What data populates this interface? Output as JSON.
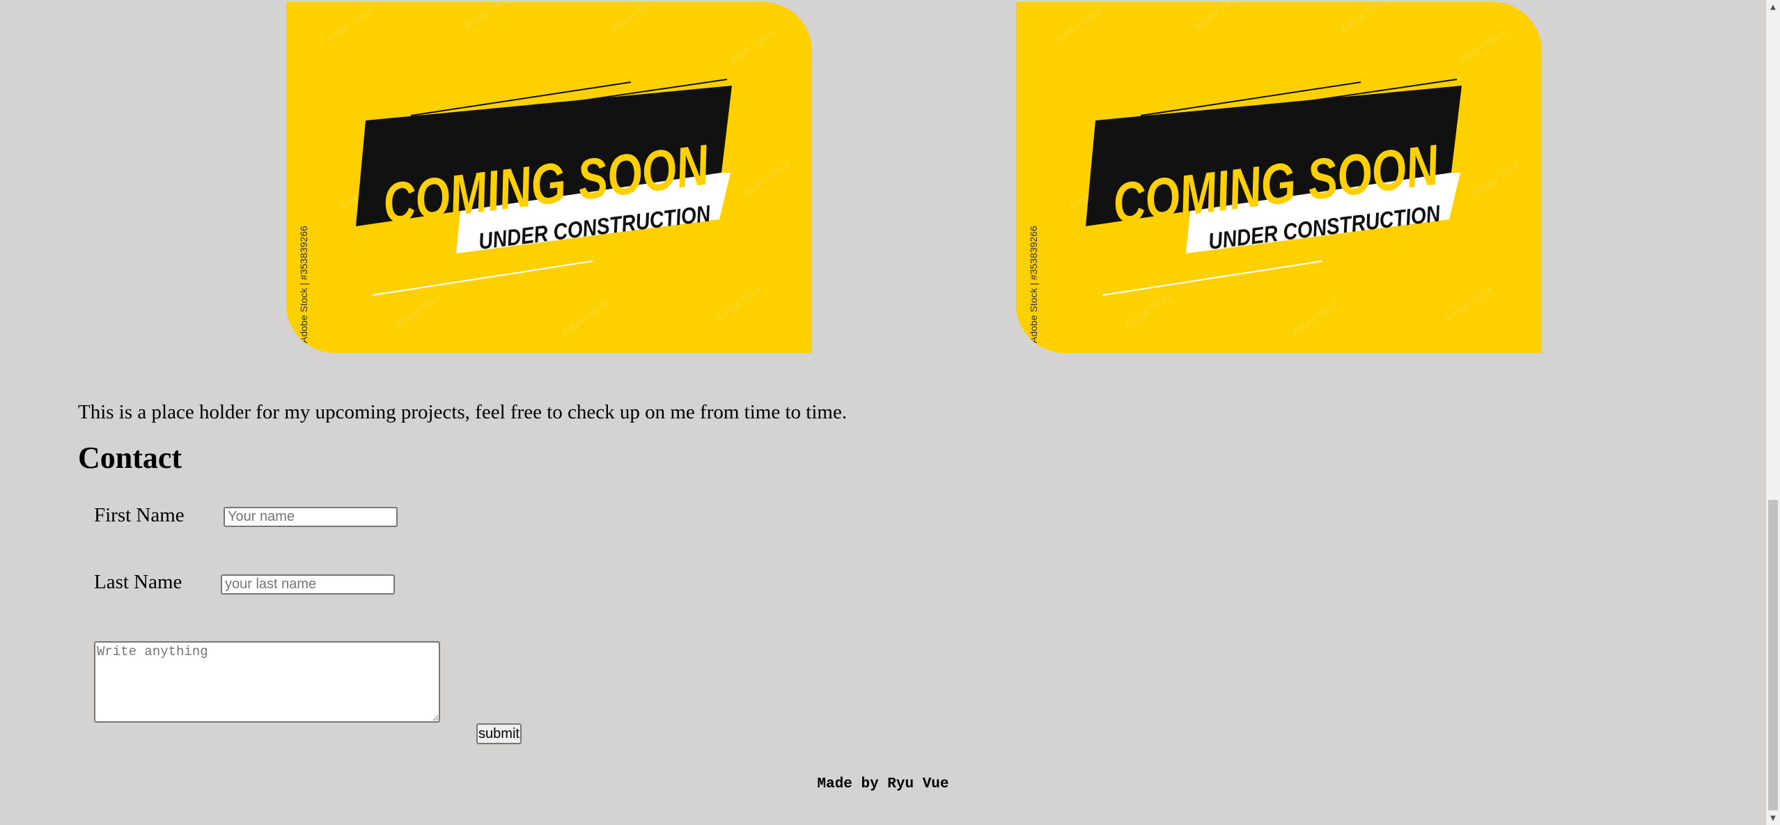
{
  "projects": {
    "cards": [
      {
        "headline": "COMING SOON",
        "subline": "UNDER CONSTRUCTION",
        "watermark_side": "Adobe Stock | #353839266",
        "watermark_tile": "Adobe Stock"
      },
      {
        "headline": "COMING SOON",
        "subline": "UNDER CONSTRUCTION",
        "watermark_side": "Adobe Stock | #353839266",
        "watermark_tile": "Adobe Stock"
      }
    ],
    "card_background_color": "#fed000",
    "banner_color": "#111111",
    "headline_color": "#fed000"
  },
  "intro": {
    "text": "This is a place holder for my upcoming projects, feel free to check up on me from time to time."
  },
  "contact": {
    "heading": "Contact",
    "first_name_label": "First Name",
    "first_name_placeholder": "Your name",
    "first_name_value": "",
    "last_name_label": "Last Name",
    "last_name_placeholder": "your last name",
    "last_name_value": "",
    "message_placeholder": "Write anything",
    "message_value": "",
    "submit_label": "submit"
  },
  "footer": {
    "credit": "Made by Ryu Vue"
  },
  "colors": {
    "page_background": "#d4d3d2"
  }
}
